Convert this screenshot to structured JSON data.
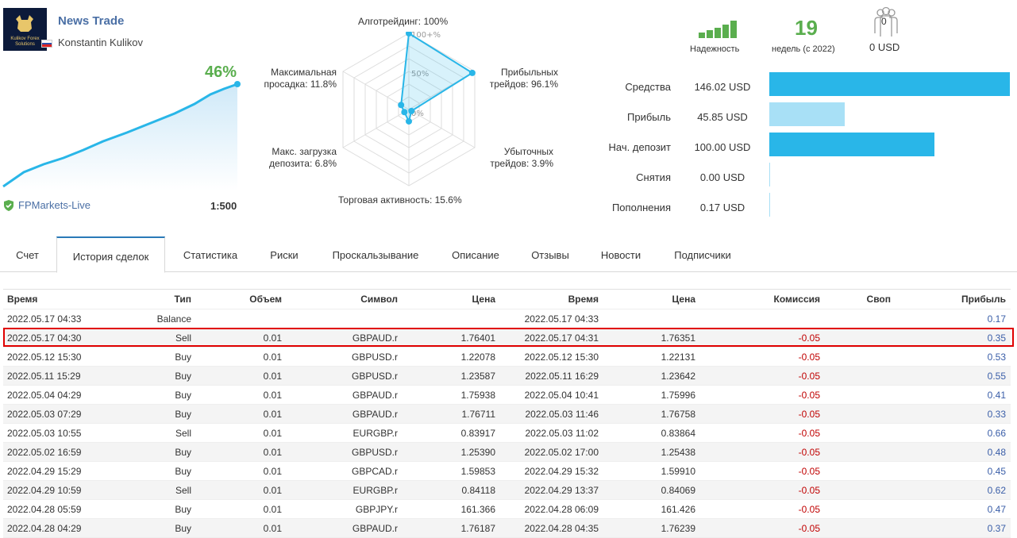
{
  "header": {
    "title": "News Trade",
    "author": "Konstantin Kulikov",
    "logo_text": "Kulikov Forex Solutions",
    "growth_percent": "46%",
    "broker": "FPMarkets-Live",
    "leverage": "1:500"
  },
  "radar": {
    "algo": "Алготрейдинг: 100%",
    "profit_trades_1": "Прибыльных",
    "profit_trades_2": "трейдов: 96.1%",
    "loss_trades_1": "Убыточных",
    "loss_trades_2": "трейдов: 3.9%",
    "activity": "Торговая активность: 15.6%",
    "load_1": "Макс. загрузка",
    "load_2": "депозита: 6.8%",
    "drawdown_1": "Максимальная",
    "drawdown_2": "просадка: 11.8%",
    "tick_100": "100+%",
    "tick_50": "50%",
    "tick_0": "0%",
    "values": {
      "algo": 100,
      "profit": 96.1,
      "loss": 3.9,
      "activity": 15.6,
      "load": 6.8,
      "drawdown": 11.8
    }
  },
  "stats": {
    "reliability_label": "Надежность",
    "weeks": "19",
    "weeks_label": "недель (с 2022)",
    "subscribers": "0",
    "subscribers_usd": "0 USD"
  },
  "finance": [
    {
      "label": "Средства",
      "value": "146.02 USD",
      "fill": 1.0,
      "color": "#29b6e8"
    },
    {
      "label": "Прибыль",
      "value": "45.85 USD",
      "fill": 0.314,
      "color": "#a8e0f6"
    },
    {
      "label": "Нач. депозит",
      "value": "100.00 USD",
      "fill": 0.685,
      "color": "#29b6e8"
    },
    {
      "label": "Снятия",
      "value": "0.00 USD",
      "fill": 0.0,
      "color": "#29b6e8"
    },
    {
      "label": "Пополнения",
      "value": "0.17 USD",
      "fill": 0.001,
      "color": "#29b6e8"
    }
  ],
  "tabs": [
    "Счет",
    "История сделок",
    "Статистика",
    "Риски",
    "Проскальзывание",
    "Описание",
    "Отзывы",
    "Новости",
    "Подписчики"
  ],
  "table": {
    "headers": [
      "Время",
      "Тип",
      "Объем",
      "Символ",
      "Цена",
      "Время",
      "Цена",
      "Комиссия",
      "Своп",
      "Прибыль"
    ],
    "rows": [
      [
        "2022.05.17 04:33",
        "Balance",
        "",
        "",
        "",
        "2022.05.17 04:33",
        "",
        "",
        "",
        "0.17"
      ],
      [
        "2022.05.17 04:30",
        "Sell",
        "0.01",
        "GBPAUD.r",
        "1.76401",
        "2022.05.17 04:31",
        "1.76351",
        "-0.05",
        "",
        "0.35"
      ],
      [
        "2022.05.12 15:30",
        "Buy",
        "0.01",
        "GBPUSD.r",
        "1.22078",
        "2022.05.12 15:30",
        "1.22131",
        "-0.05",
        "",
        "0.53"
      ],
      [
        "2022.05.11 15:29",
        "Buy",
        "0.01",
        "GBPUSD.r",
        "1.23587",
        "2022.05.11 16:29",
        "1.23642",
        "-0.05",
        "",
        "0.55"
      ],
      [
        "2022.05.04 04:29",
        "Buy",
        "0.01",
        "GBPAUD.r",
        "1.75938",
        "2022.05.04 10:41",
        "1.75996",
        "-0.05",
        "",
        "0.41"
      ],
      [
        "2022.05.03 07:29",
        "Buy",
        "0.01",
        "GBPAUD.r",
        "1.76711",
        "2022.05.03 11:46",
        "1.76758",
        "-0.05",
        "",
        "0.33"
      ],
      [
        "2022.05.03 10:55",
        "Sell",
        "0.01",
        "EURGBP.r",
        "0.83917",
        "2022.05.03 11:02",
        "0.83864",
        "-0.05",
        "",
        "0.66"
      ],
      [
        "2022.05.02 16:59",
        "Buy",
        "0.01",
        "GBPUSD.r",
        "1.25390",
        "2022.05.02 17:00",
        "1.25438",
        "-0.05",
        "",
        "0.48"
      ],
      [
        "2022.04.29 15:29",
        "Buy",
        "0.01",
        "GBPCAD.r",
        "1.59853",
        "2022.04.29 15:32",
        "1.59910",
        "-0.05",
        "",
        "0.45"
      ],
      [
        "2022.04.29 10:59",
        "Sell",
        "0.01",
        "EURGBP.r",
        "0.84118",
        "2022.04.29 13:37",
        "0.84069",
        "-0.05",
        "",
        "0.62"
      ],
      [
        "2022.04.28 05:59",
        "Buy",
        "0.01",
        "GBPJPY.r",
        "161.366",
        "2022.04.28 06:09",
        "161.426",
        "-0.05",
        "",
        "0.47"
      ],
      [
        "2022.04.28 04:29",
        "Buy",
        "0.01",
        "GBPAUD.r",
        "1.76187",
        "2022.04.28 04:35",
        "1.76239",
        "-0.05",
        "",
        "0.37"
      ]
    ]
  },
  "colors": {
    "accent": "#29b6e8",
    "green": "#5aae4e",
    "negative": "#c00000",
    "positive": "#3a5ea8",
    "highlight": "#e00000"
  }
}
